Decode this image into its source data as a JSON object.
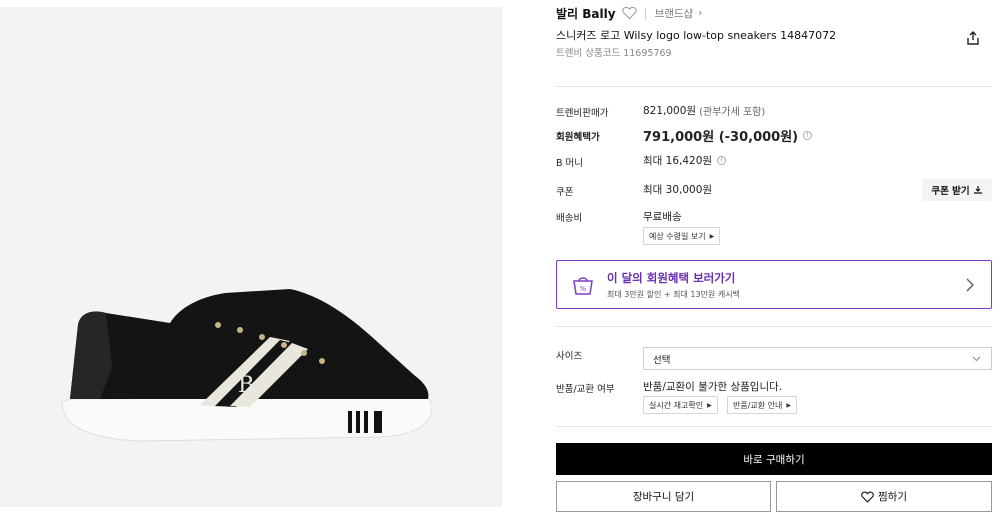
{
  "brand": {
    "name": "발리 Bally",
    "shop_link": "브랜드샵"
  },
  "product": {
    "title": "스니커즈 로고 Wilsy logo low-top sneakers 14847072",
    "code": "트렌비 상품코드 11695769"
  },
  "pricing": {
    "sale_label": "트렌비판매가",
    "sale_price": "821,000원",
    "sale_note": "(관부가세 포함)",
    "member_label": "회원혜택가",
    "member_price": "791,000원 (-30,000원)",
    "bmoney_label": "B 머니",
    "bmoney_value": "최대 16,420원",
    "coupon_label": "쿠폰",
    "coupon_value": "최대 30,000원",
    "coupon_button": "쿠폰 받기"
  },
  "shipping": {
    "label": "배송비",
    "value": "무료배송",
    "estimate_button": "예상 수령일 보기"
  },
  "benefit_banner": {
    "title": "이 달의 회원혜택 보러가기",
    "subtitle": "최대 3만원 할인 + 최대 13만원 캐시백"
  },
  "size": {
    "label": "사이즈",
    "selected": "선택"
  },
  "returns": {
    "label": "반품/교환 여부",
    "value": "반품/교환이 불가한 상품입니다.",
    "btn_stock": "실시간 재고확인",
    "btn_guide": "반품/교환 안내"
  },
  "actions": {
    "buy_now": "바로 구매하기",
    "cart": "장바구니 담기",
    "wishlist": "찜하기"
  },
  "colors": {
    "accent_purple": "#6b2fb3",
    "buy_bg": "#000000"
  }
}
